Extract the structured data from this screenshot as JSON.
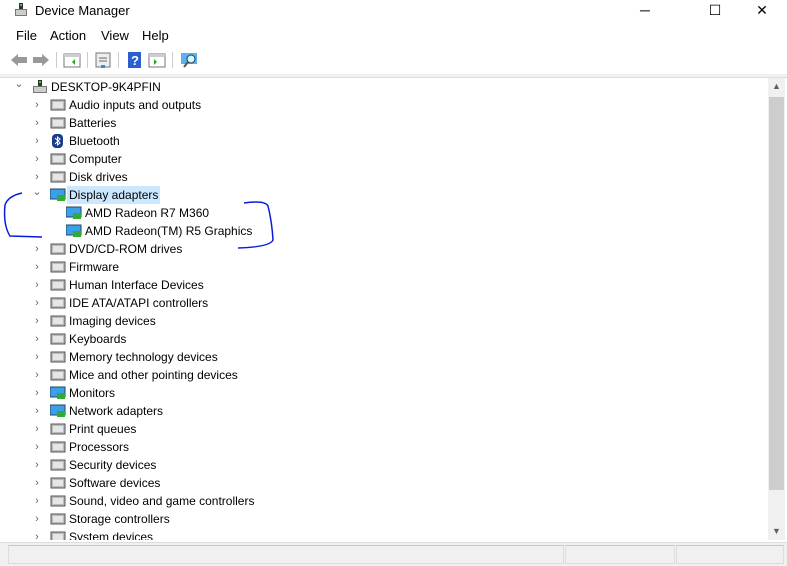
{
  "window": {
    "title": "Device Manager",
    "minimize": "─",
    "maximize": "☐",
    "close": "✕"
  },
  "menu": [
    "File",
    "Action",
    "View",
    "Help"
  ],
  "toolbar": [
    "back",
    "forward",
    "show-hide-console-tree",
    "properties",
    "help",
    "show-action-pane",
    "scan-hardware"
  ],
  "tree": {
    "root": "DESKTOP-9K4PFIN",
    "categories": [
      {
        "label": "Audio inputs and outputs",
        "icon": "speaker-icon"
      },
      {
        "label": "Batteries",
        "icon": "battery-icon"
      },
      {
        "label": "Bluetooth",
        "icon": "bluetooth-icon"
      },
      {
        "label": "Computer",
        "icon": "computer-icon"
      },
      {
        "label": "Disk drives",
        "icon": "disk-icon"
      },
      {
        "label": "Display adapters",
        "icon": "display-adapter-icon",
        "expanded": true,
        "selected": true,
        "children": [
          "AMD Radeon R7 M360",
          "AMD Radeon(TM) R5 Graphics"
        ]
      },
      {
        "label": "DVD/CD-ROM drives",
        "icon": "dvd-icon"
      },
      {
        "label": "Firmware",
        "icon": "firmware-icon"
      },
      {
        "label": "Human Interface Devices",
        "icon": "hid-icon"
      },
      {
        "label": "IDE ATA/ATAPI controllers",
        "icon": "ide-icon"
      },
      {
        "label": "Imaging devices",
        "icon": "camera-icon"
      },
      {
        "label": "Keyboards",
        "icon": "keyboard-icon"
      },
      {
        "label": "Memory technology devices",
        "icon": "memory-icon"
      },
      {
        "label": "Mice and other pointing devices",
        "icon": "mouse-icon"
      },
      {
        "label": "Monitors",
        "icon": "monitor-icon"
      },
      {
        "label": "Network adapters",
        "icon": "network-icon"
      },
      {
        "label": "Print queues",
        "icon": "printer-icon"
      },
      {
        "label": "Processors",
        "icon": "processor-icon"
      },
      {
        "label": "Security devices",
        "icon": "security-icon"
      },
      {
        "label": "Software devices",
        "icon": "software-icon"
      },
      {
        "label": "Sound, video and game controllers",
        "icon": "sound-icon"
      },
      {
        "label": "Storage controllers",
        "icon": "storage-icon"
      },
      {
        "label": "System devices",
        "icon": "system-icon"
      }
    ]
  },
  "colors": {
    "selection": "#cce8ff",
    "annotation": "#0a1adc"
  }
}
